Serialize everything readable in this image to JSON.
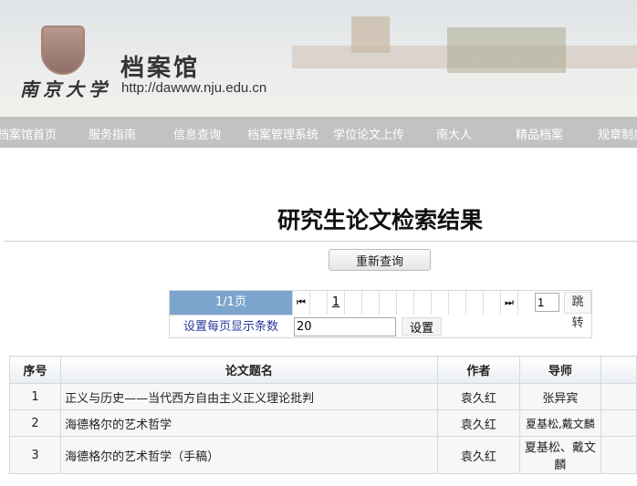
{
  "header": {
    "site_name": "档案馆",
    "university": "南京大学",
    "url": "http://dawww.nju.edu.cn"
  },
  "nav": [
    "档案馆首页",
    "服务指南",
    "信息查询",
    "档案管理系统",
    "学位论文上传",
    "南大人",
    "精品档案",
    "规章制度"
  ],
  "page_title": "研究生论文检索结果",
  "requery_label": "重新查询",
  "pager": {
    "page_info": "1/1页",
    "first_icon": "⏮",
    "current_page": "1",
    "last_icon": "⏭",
    "goto_value": "1",
    "goto_label_1": "跳",
    "goto_label_2": "转",
    "per_page_label": "设置每页显示条数",
    "per_page_value": "20",
    "set_label": "设置"
  },
  "table": {
    "headers": [
      "序号",
      "论文题名",
      "作者",
      "导师",
      ""
    ],
    "rows": [
      {
        "no": "1",
        "title": "正义与历史——当代西方自由主义正义理论批判",
        "author": "袁久红",
        "advisor": "张异宾"
      },
      {
        "no": "2",
        "title": "海德格尔的艺术哲学",
        "author": "袁久红",
        "advisor": "夏基松,戴文麟"
      },
      {
        "no": "3",
        "title": "海德格尔的艺术哲学（手稿）",
        "author": "袁久红",
        "advisor": "夏基松、戴文麟"
      }
    ]
  }
}
